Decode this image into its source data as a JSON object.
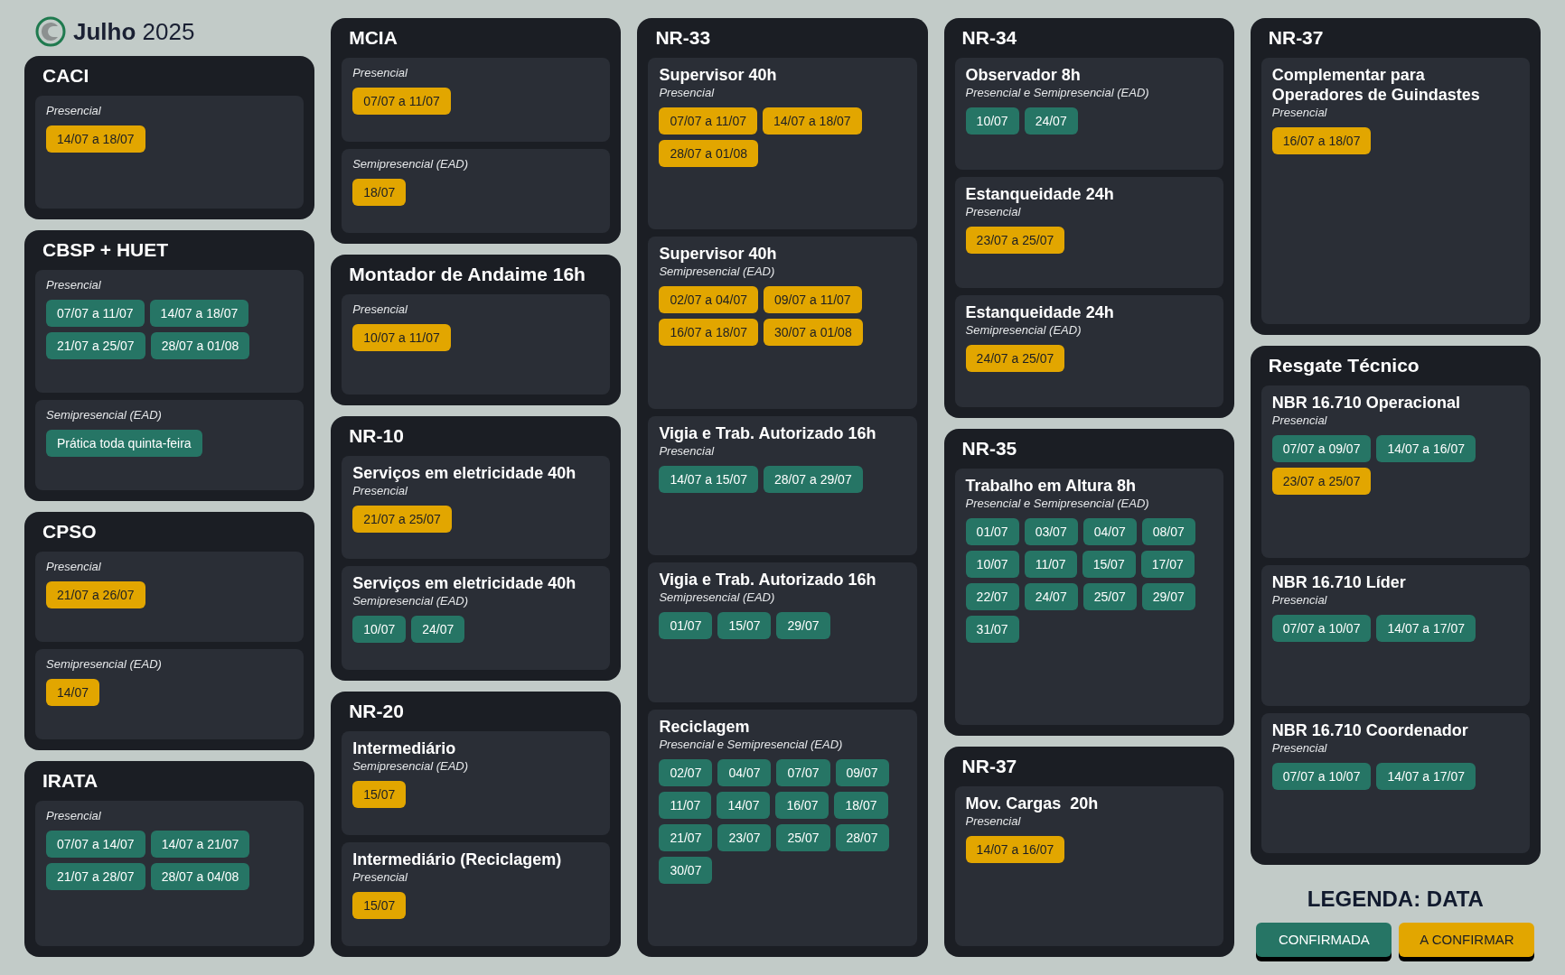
{
  "header": {
    "title": "**Julho** 2025"
  },
  "columns": [
    {
      "cards": [
        {
          "title": "CACI",
          "sections": [
            {
              "mode": "Presencial",
              "dates": [
                {
                  "text": "14/07 a 18/07",
                  "confirmed": false
                }
              ]
            }
          ]
        },
        {
          "title": "CBSP + HUET",
          "sections": [
            {
              "mode": "Presencial",
              "dates": [
                {
                  "text": "07/07 a 11/07",
                  "confirmed": true
                },
                {
                  "text": "14/07 a 18/07",
                  "confirmed": true
                },
                {
                  "text": "21/07 a 25/07",
                  "confirmed": true
                },
                {
                  "text": "28/07 a 01/08",
                  "confirmed": true
                }
              ]
            },
            {
              "mode": "Semipresencial (EAD)",
              "dates": [
                {
                  "text": "Prática toda quinta-feira",
                  "confirmed": true
                }
              ]
            }
          ]
        },
        {
          "title": "CPSO",
          "sections": [
            {
              "mode": "Presencial",
              "dates": [
                {
                  "text": "21/07 a 26/07",
                  "confirmed": false
                }
              ]
            },
            {
              "mode": "Semipresencial (EAD)",
              "dates": [
                {
                  "text": "14/07",
                  "confirmed": false
                }
              ]
            }
          ]
        },
        {
          "title": "IRATA",
          "sections": [
            {
              "mode": "Presencial",
              "dates": [
                {
                  "text": "07/07 a 14/07",
                  "confirmed": true
                },
                {
                  "text": "14/07 a 21/07",
                  "confirmed": true
                },
                {
                  "text": "21/07 a 28/07",
                  "confirmed": true
                },
                {
                  "text": "28/07 a 04/08",
                  "confirmed": true
                }
              ]
            }
          ]
        }
      ]
    },
    {
      "cards": [
        {
          "title": "MCIA",
          "sections": [
            {
              "mode": "Presencial",
              "dates": [
                {
                  "text": "07/07 a 11/07",
                  "confirmed": false
                }
              ]
            },
            {
              "mode": "Semipresencial (EAD)",
              "dates": [
                {
                  "text": "18/07",
                  "confirmed": false
                }
              ]
            }
          ]
        },
        {
          "title": "Montador de Andaime 16h",
          "sections": [
            {
              "mode": "Presencial",
              "dates": [
                {
                  "text": "10/07 a 11/07",
                  "confirmed": false
                }
              ]
            }
          ]
        },
        {
          "title": "NR-10",
          "sections": [
            {
              "name": "Serviços em eletricidade 40h",
              "mode": "Presencial",
              "dates": [
                {
                  "text": "21/07 a 25/07",
                  "confirmed": false
                }
              ]
            },
            {
              "name": "Serviços em eletricidade 40h",
              "mode": "Semipresencial (EAD)",
              "dates": [
                {
                  "text": "10/07",
                  "confirmed": true
                },
                {
                  "text": "24/07",
                  "confirmed": true
                }
              ]
            }
          ]
        },
        {
          "title": "NR-20",
          "sections": [
            {
              "name": "Intermediário",
              "mode": "Semipresencial (EAD)",
              "dates": [
                {
                  "text": "15/07",
                  "confirmed": false
                }
              ]
            },
            {
              "name": "Intermediário (Reciclagem)",
              "mode": "Presencial",
              "dates": [
                {
                  "text": "15/07",
                  "confirmed": false
                }
              ]
            }
          ]
        }
      ]
    },
    {
      "cards": [
        {
          "title": "NR-33",
          "sections": [
            {
              "name": "Supervisor 40h",
              "mode": "Presencial",
              "dates": [
                {
                  "text": "07/07 a 11/07",
                  "confirmed": false
                },
                {
                  "text": "14/07 a 18/07",
                  "confirmed": false
                },
                {
                  "text": "28/07 a 01/08",
                  "confirmed": false
                }
              ]
            },
            {
              "name": "Supervisor 40h",
              "mode": "Semipresencial (EAD)",
              "dates": [
                {
                  "text": "02/07 a 04/07",
                  "confirmed": false
                },
                {
                  "text": "09/07 a 11/07",
                  "confirmed": false
                },
                {
                  "text": "16/07 a 18/07",
                  "confirmed": false
                },
                {
                  "text": "30/07 a 01/08",
                  "confirmed": false
                }
              ]
            },
            {
              "name": "Vigia e Trab. Autorizado 16h",
              "mode": "Presencial",
              "dates": [
                {
                  "text": "14/07 a 15/07",
                  "confirmed": true
                },
                {
                  "text": "28/07 a 29/07",
                  "confirmed": true
                }
              ]
            },
            {
              "name": "Vigia e Trab. Autorizado 16h",
              "mode": "Semipresencial (EAD)",
              "dates": [
                {
                  "text": "01/07",
                  "confirmed": true
                },
                {
                  "text": "15/07",
                  "confirmed": true
                },
                {
                  "text": "29/07",
                  "confirmed": true
                }
              ]
            },
            {
              "name": "Reciclagem",
              "mode": "Presencial e Semipresencial (EAD)",
              "dates": [
                {
                  "text": "02/07",
                  "confirmed": true
                },
                {
                  "text": "04/07",
                  "confirmed": true
                },
                {
                  "text": "07/07",
                  "confirmed": true
                },
                {
                  "text": "09/07",
                  "confirmed": true
                },
                {
                  "text": "11/07",
                  "confirmed": true
                },
                {
                  "text": "14/07",
                  "confirmed": true
                },
                {
                  "text": "16/07",
                  "confirmed": true
                },
                {
                  "text": "18/07",
                  "confirmed": true
                },
                {
                  "text": "21/07",
                  "confirmed": true
                },
                {
                  "text": "23/07",
                  "confirmed": true
                },
                {
                  "text": "25/07",
                  "confirmed": true
                },
                {
                  "text": "28/07",
                  "confirmed": true
                },
                {
                  "text": "30/07",
                  "confirmed": true
                }
              ]
            }
          ]
        }
      ]
    },
    {
      "cards": [
        {
          "title": "NR-34",
          "sections": [
            {
              "name": "Observador 8h",
              "mode": "Presencial e Semipresencial (EAD)",
              "dates": [
                {
                  "text": "10/07",
                  "confirmed": true
                },
                {
                  "text": "24/07",
                  "confirmed": true
                }
              ]
            },
            {
              "name": "Estanqueidade 24h",
              "mode": "Presencial",
              "dates": [
                {
                  "text": "23/07 a 25/07",
                  "confirmed": false
                }
              ]
            },
            {
              "name": "Estanqueidade 24h",
              "mode": "Semipresencial (EAD)",
              "dates": [
                {
                  "text": "24/07 a 25/07",
                  "confirmed": false
                }
              ]
            }
          ]
        },
        {
          "title": "NR-35",
          "sections": [
            {
              "name": "Trabalho em Altura 8h",
              "mode": "Presencial e Semipresencial (EAD)",
              "dates": [
                {
                  "text": "01/07",
                  "confirmed": true
                },
                {
                  "text": "03/07",
                  "confirmed": true
                },
                {
                  "text": "04/07",
                  "confirmed": true
                },
                {
                  "text": "08/07",
                  "confirmed": true
                },
                {
                  "text": "10/07",
                  "confirmed": true
                },
                {
                  "text": "11/07",
                  "confirmed": true
                },
                {
                  "text": "15/07",
                  "confirmed": true
                },
                {
                  "text": "17/07",
                  "confirmed": true
                },
                {
                  "text": "22/07",
                  "confirmed": true
                },
                {
                  "text": "24/07",
                  "confirmed": true
                },
                {
                  "text": "25/07",
                  "confirmed": true
                },
                {
                  "text": "29/07",
                  "confirmed": true
                },
                {
                  "text": "31/07",
                  "confirmed": true
                }
              ]
            }
          ]
        },
        {
          "title": "NR-37",
          "sections": [
            {
              "name": "Mov. Cargas  20h",
              "mode": "Presencial",
              "dates": [
                {
                  "text": "14/07 a 16/07",
                  "confirmed": false
                }
              ]
            }
          ]
        }
      ]
    },
    {
      "cards": [
        {
          "title": "NR-37",
          "sections": [
            {
              "name": "Complementar para Operadores de Guindastes",
              "mode": "Presencial",
              "dates": [
                {
                  "text": "16/07 a 18/07",
                  "confirmed": false
                }
              ]
            }
          ]
        },
        {
          "title": "Resgate Técnico",
          "sections": [
            {
              "name": "NBR 16.710 Operacional",
              "mode": "Presencial",
              "dates": [
                {
                  "text": "07/07 a 09/07",
                  "confirmed": true
                },
                {
                  "text": "14/07 a 16/07",
                  "confirmed": true
                },
                {
                  "text": "23/07 a 25/07",
                  "confirmed": false
                }
              ]
            },
            {
              "name": "NBR 16.710 Líder",
              "mode": "Presencial",
              "dates": [
                {
                  "text": "07/07 a 10/07",
                  "confirmed": true
                },
                {
                  "text": "14/07 a 17/07",
                  "confirmed": true
                }
              ]
            },
            {
              "name": "NBR 16.710 Coordenador",
              "mode": "Presencial",
              "dates": [
                {
                  "text": "07/07 a 10/07",
                  "confirmed": true
                },
                {
                  "text": "14/07 a 17/07",
                  "confirmed": true
                }
              ]
            }
          ]
        }
      ]
    }
  ],
  "legend": {
    "title": "LEGENDA: DATA",
    "items": [
      {
        "label": "CONFIRMADA",
        "confirmed": true
      },
      {
        "label": "A CONFIRMAR",
        "confirmed": false
      }
    ]
  }
}
